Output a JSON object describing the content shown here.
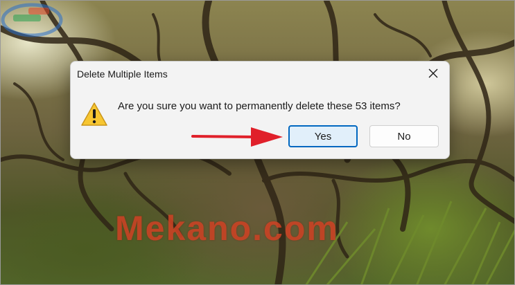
{
  "dialog": {
    "title": "Delete Multiple Items",
    "message": "Are you sure you want to permanently delete these 53 items?",
    "icon": "warning-icon",
    "buttons": {
      "yes_label": "Yes",
      "no_label": "No"
    },
    "close_icon": "close-icon"
  },
  "annotation": {
    "arrow_color": "#e0202a"
  },
  "watermark": {
    "text": "Mekano.com"
  },
  "colors": {
    "accent": "#0067c0",
    "warning_fill": "#f7c631",
    "dialog_bg": "#f3f3f3"
  }
}
